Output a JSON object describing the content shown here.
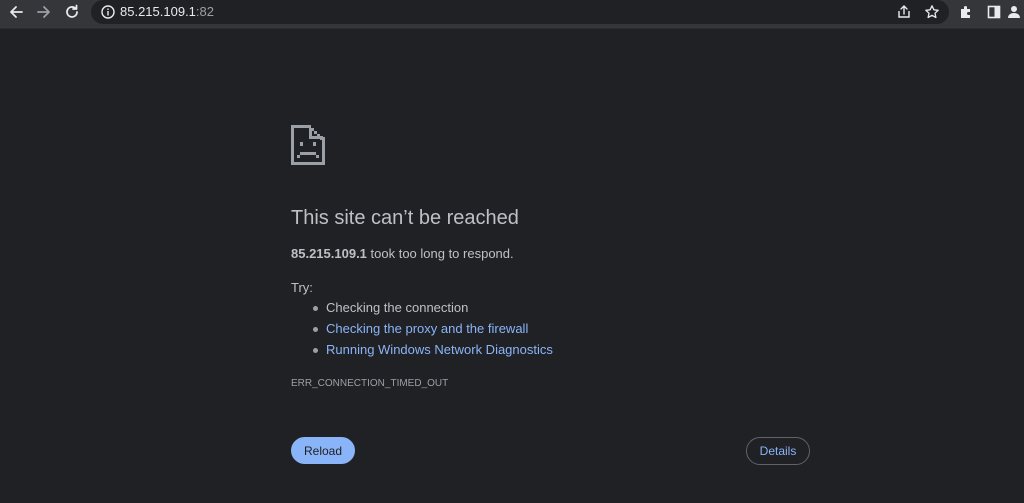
{
  "toolbar": {
    "back_icon": "arrow-back-icon",
    "forward_icon": "arrow-forward-icon",
    "reload_icon": "reload-icon",
    "info_icon": "info-icon",
    "share_icon": "share-icon",
    "bookmark_icon": "star-icon",
    "extensions_icon": "puzzle-icon",
    "side_panel_icon": "side-panel-icon",
    "profile_icon": "profile-icon"
  },
  "omnibox": {
    "host": "85.215.109.1",
    "port": ":82"
  },
  "error_page": {
    "title": "This site can’t be reached",
    "host_bold": "85.215.109.1",
    "description_rest": " took too long to respond.",
    "try_label": "Try:",
    "suggestions": [
      {
        "label": "Checking the connection",
        "link": false
      },
      {
        "label": "Checking the proxy and the firewall",
        "link": true
      },
      {
        "label": "Running Windows Network Diagnostics",
        "link": true
      }
    ],
    "error_code": "ERR_CONNECTION_TIMED_OUT",
    "reload_label": "Reload",
    "details_label": "Details"
  },
  "colors": {
    "page_bg": "#202124",
    "toolbar_bg": "#35363a",
    "text": "#bdc1c6",
    "link": "#8ab4f8",
    "primary_button": "#8ab4f8"
  }
}
